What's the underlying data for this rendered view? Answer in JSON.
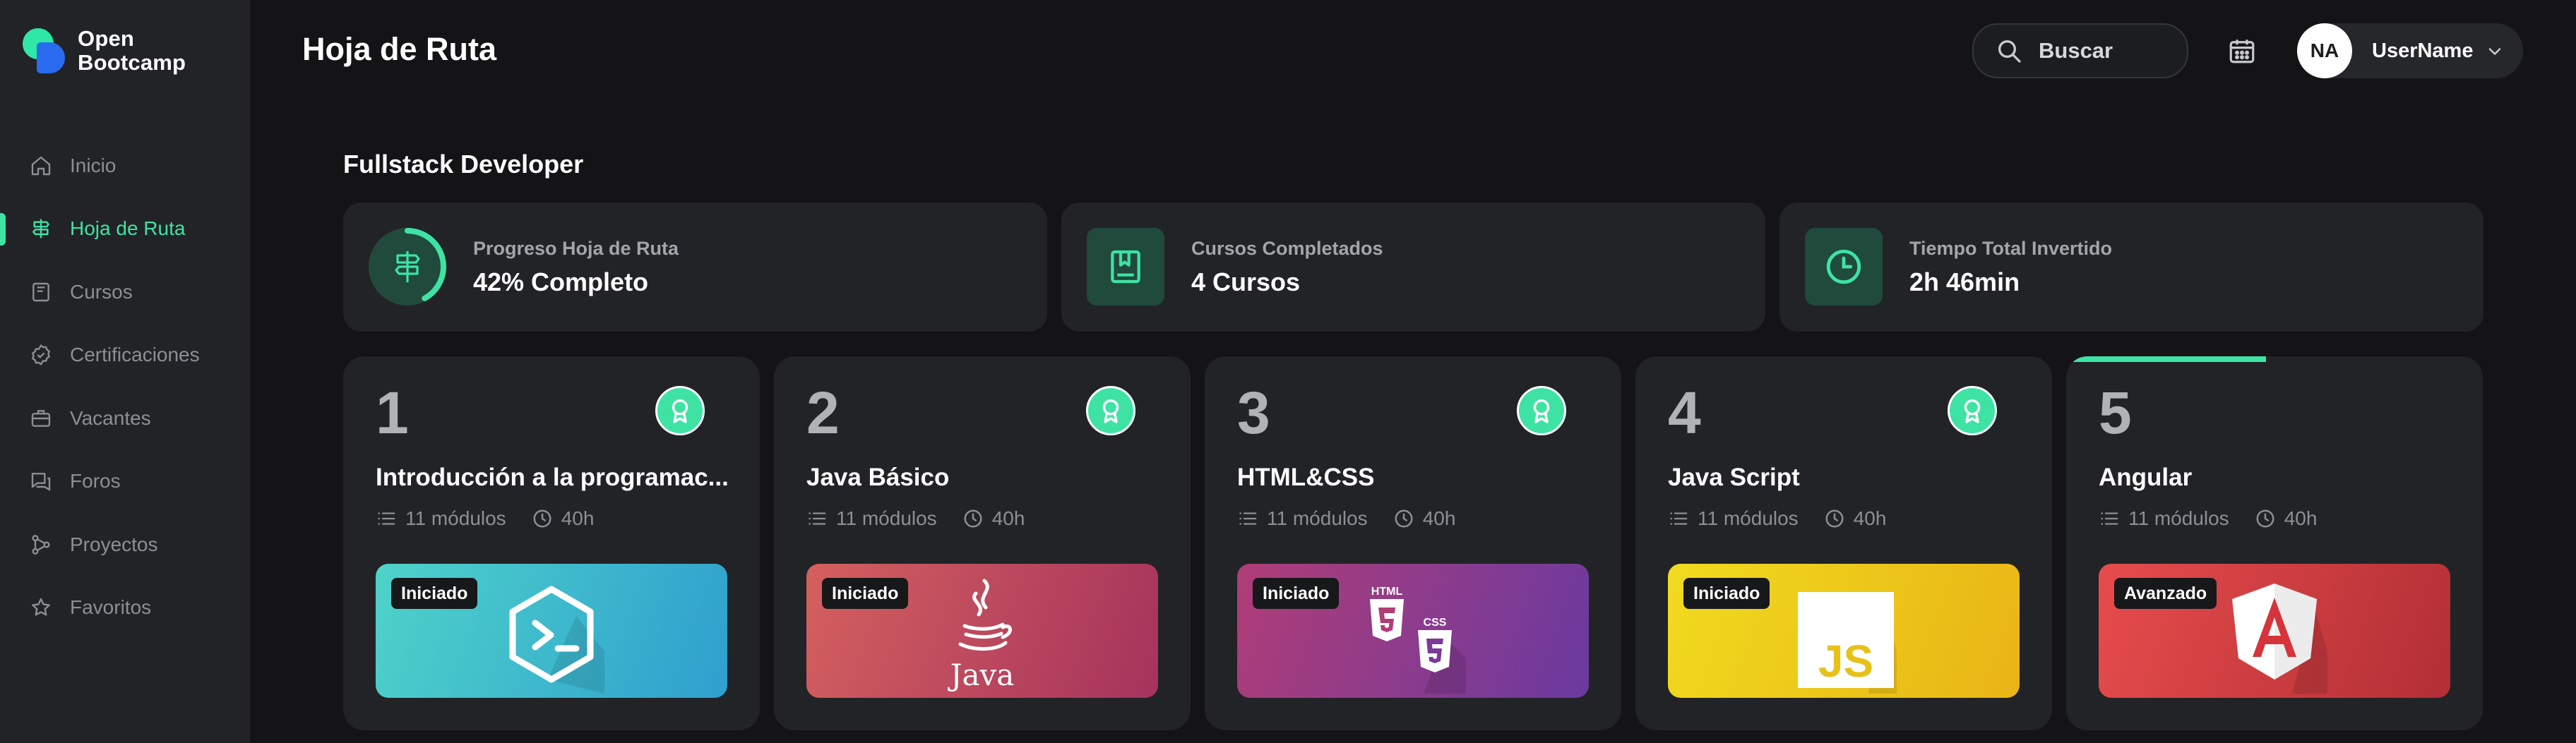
{
  "brand": {
    "name_line1": "Open",
    "name_line2": "Bootcamp"
  },
  "sidebar": {
    "items": [
      {
        "label": "Inicio",
        "icon": "home-icon",
        "active": false
      },
      {
        "label": "Hoja de Ruta",
        "icon": "signpost-icon",
        "active": true
      },
      {
        "label": "Cursos",
        "icon": "book-icon",
        "active": false
      },
      {
        "label": "Certificaciones",
        "icon": "certificate-icon",
        "active": false
      },
      {
        "label": "Vacantes",
        "icon": "briefcase-icon",
        "active": false
      },
      {
        "label": "Foros",
        "icon": "chat-icon",
        "active": false
      },
      {
        "label": "Proyectos",
        "icon": "branch-icon",
        "active": false
      },
      {
        "label": "Favoritos",
        "icon": "star-icon",
        "active": false
      }
    ]
  },
  "header": {
    "title": "Hoja de Ruta",
    "search_placeholder": "Buscar",
    "user": {
      "initials": "NA",
      "name": "UserName"
    }
  },
  "section": {
    "title": "Fullstack Developer"
  },
  "stats": [
    {
      "label": "Progreso Hoja de Ruta",
      "value": "42% Completo",
      "progress": 0.42,
      "icon": "signpost-icon"
    },
    {
      "label": "Cursos Completados",
      "value": "4 Cursos",
      "icon": "book-icon"
    },
    {
      "label": "Tiempo Total Invertido",
      "value": "2h 46min",
      "icon": "clock-icon"
    }
  ],
  "courses": [
    {
      "number": "1",
      "title": "Introducción a la programac...",
      "modules": "11 módulos",
      "hours": "40h",
      "level": "Iniciado",
      "completed": true,
      "progress": 1,
      "logo": "terminal-icon",
      "gradient": [
        "#4ed3c9",
        "#2f9fcf"
      ]
    },
    {
      "number": "2",
      "title": "Java Básico",
      "modules": "11 módulos",
      "hours": "40h",
      "level": "Iniciado",
      "completed": true,
      "progress": 1,
      "logo": "java-logo-icon",
      "logo_text": "Java",
      "gradient": [
        "#d4605e",
        "#a5335d"
      ]
    },
    {
      "number": "3",
      "title": "HTML&CSS",
      "modules": "11 módulos",
      "hours": "40h",
      "level": "Iniciado",
      "completed": true,
      "progress": 1,
      "logo": "html-css-logo-icon",
      "logo_text_1": "HTML",
      "logo_text_2": "CSS",
      "gradient": [
        "#b03d77",
        "#6a3aa0"
      ]
    },
    {
      "number": "4",
      "title": "Java Script",
      "modules": "11 módulos",
      "hours": "40h",
      "level": "Iniciado",
      "completed": true,
      "progress": 1,
      "logo": "javascript-logo-icon",
      "logo_text": "JS",
      "gradient": [
        "#f0db1e",
        "#e9b416"
      ]
    },
    {
      "number": "5",
      "title": "Angular",
      "modules": "11 módulos",
      "hours": "40h",
      "level": "Avanzado",
      "completed": false,
      "progress": 0.48,
      "logo": "angular-logo-icon",
      "logo_text": "A",
      "gradient": [
        "#e74c4c",
        "#b22f35"
      ]
    }
  ],
  "colors": {
    "accent": "#3ee3a4",
    "background": "#141416",
    "panel": "#222326",
    "muted": "#8d8f94"
  }
}
